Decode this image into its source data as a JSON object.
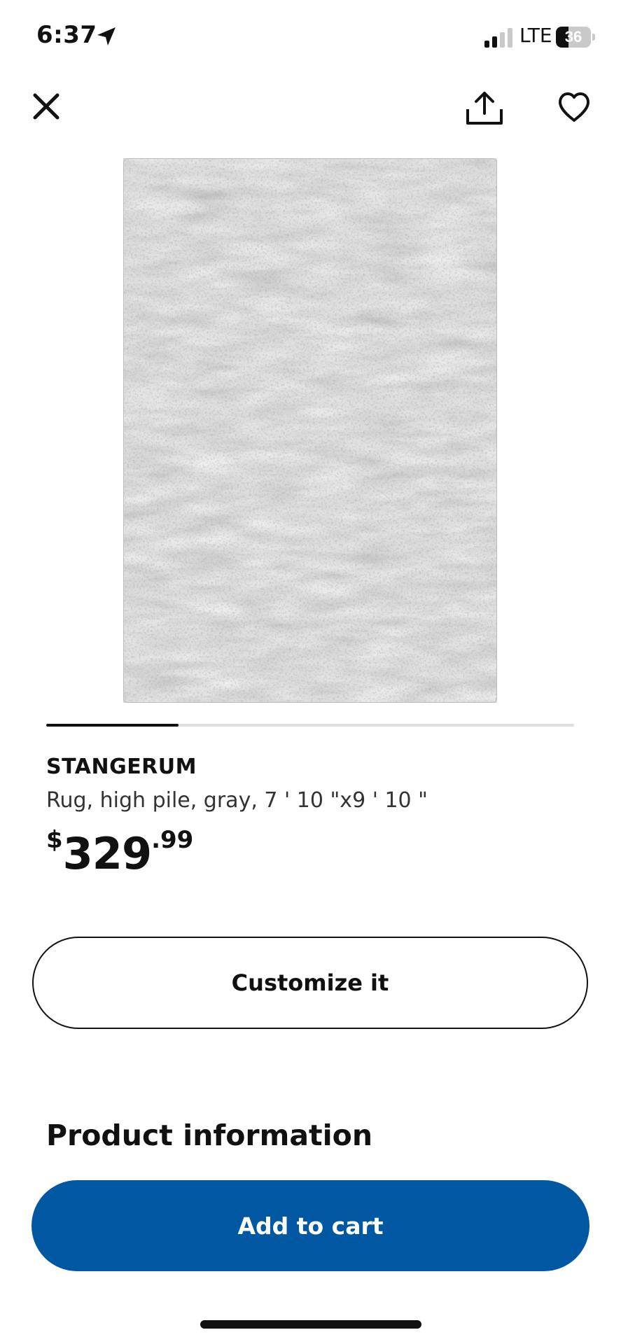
{
  "status_bar": {
    "time": "6:37",
    "network": "LTE",
    "battery_level": "36",
    "battery_fraction": 0.36
  },
  "icons": {
    "location": "location-arrow-icon",
    "signal": "cellular-signal-icon",
    "battery": "battery-icon",
    "close": "close-icon",
    "share": "share-icon",
    "favorite": "heart-icon"
  },
  "gallery": {
    "image_alt": "STANGERUM rug, high pile, gray",
    "progress": 0.25
  },
  "product": {
    "name": "STANGERUM",
    "description": "Rug, high pile, gray, 7 ' 10 \"x9 ' 10 \"",
    "price": {
      "currency": "$",
      "integer": "329",
      "decimals": ".99"
    }
  },
  "actions": {
    "customize_label": "Customize it",
    "add_to_cart_label": "Add to cart"
  },
  "sections": {
    "product_information_heading": "Product information"
  },
  "colors": {
    "primary_blue": "#0058a3",
    "text": "#111111",
    "track": "#dfdfdf",
    "rug_base": "#d9d9d9",
    "rug_dark": "#6f6f6f"
  }
}
